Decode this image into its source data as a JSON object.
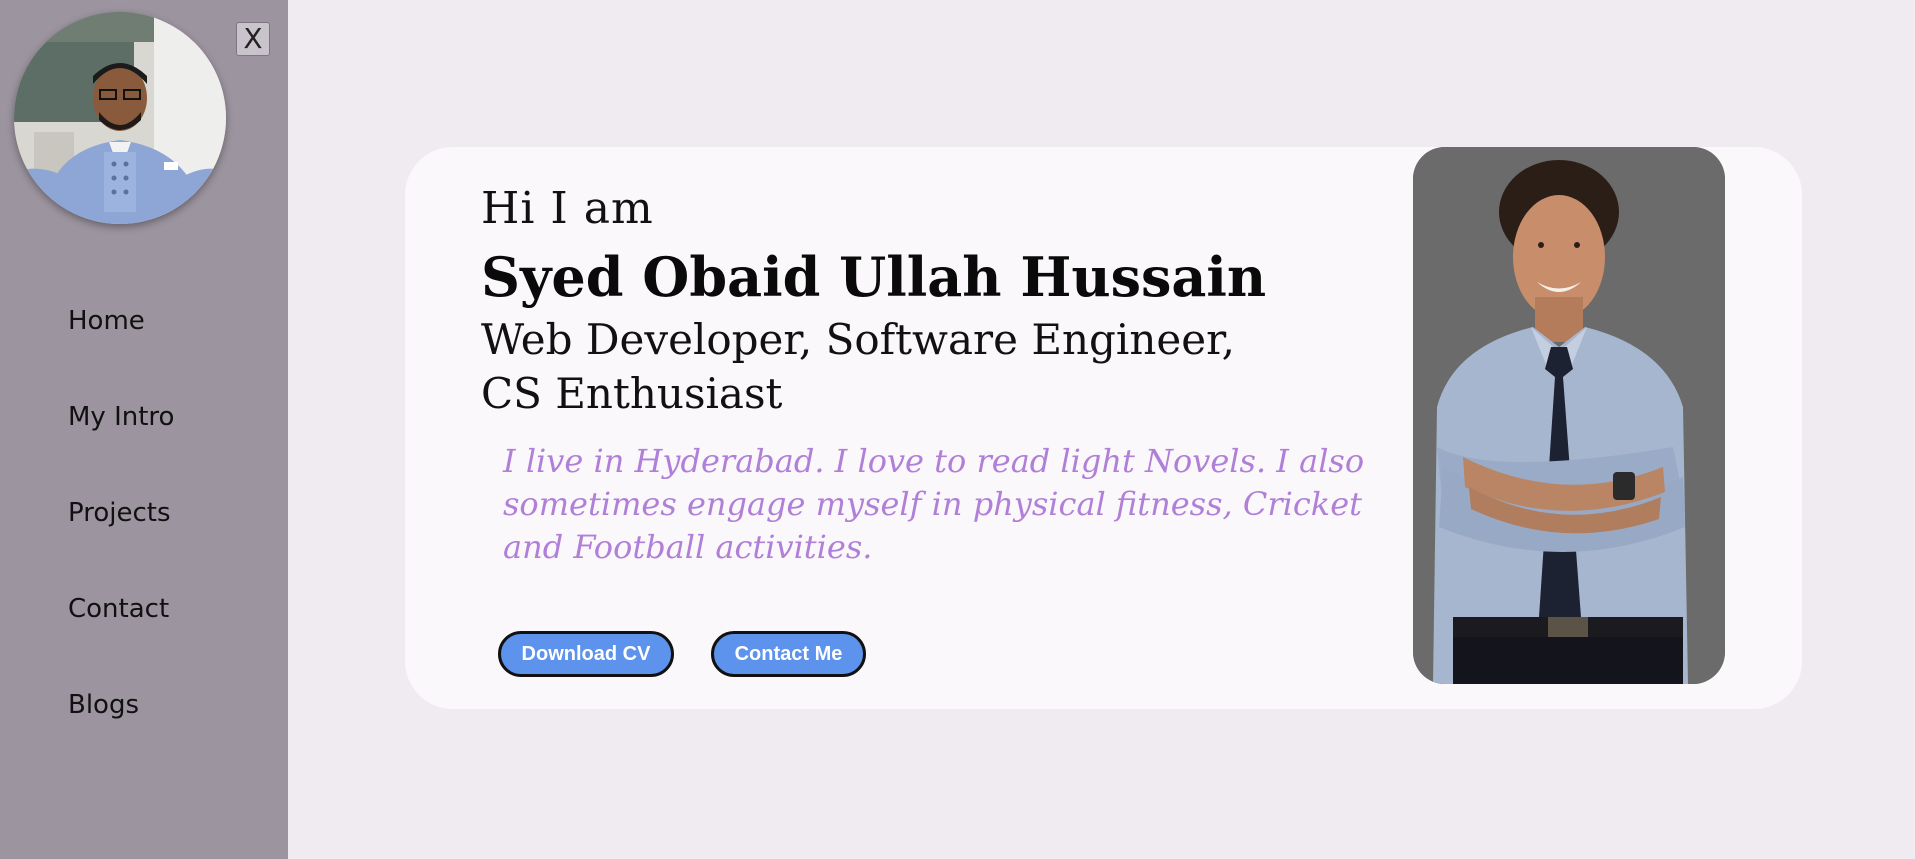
{
  "sidebar": {
    "close_label": "X",
    "items": [
      {
        "label": "Home"
      },
      {
        "label": "My Intro"
      },
      {
        "label": "Projects"
      },
      {
        "label": "Contact"
      },
      {
        "label": "Blogs"
      }
    ]
  },
  "hero": {
    "greeting": "Hi I am",
    "name": "Syed Obaid Ullah Hussain",
    "roles": "Web Developer, Software Engineer, CS Enthusiast",
    "bio": "I live in Hyderabad. I love to read light Novels. I also sometimes engage myself in physical fitness, Cricket and Football activities.",
    "download_cv_label": "Download CV",
    "contact_me_label": "Contact Me"
  },
  "colors": {
    "sidebar_bg": "#9c949f",
    "page_bg": "#f0ebf0",
    "card_bg": "#fbf8fb",
    "bio_text": "#b07fd8",
    "button_bg": "#5d93ec"
  }
}
